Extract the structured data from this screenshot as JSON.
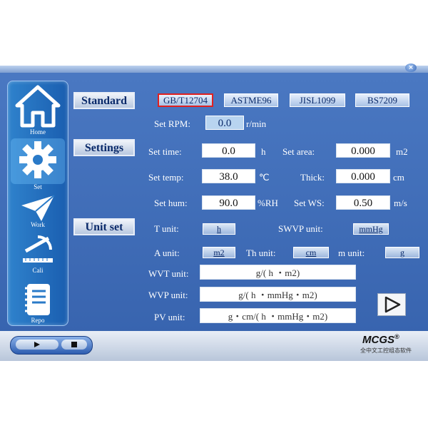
{
  "nav": [
    {
      "label": "Home",
      "icon": "home-icon"
    },
    {
      "label": "Set",
      "icon": "gear-icon"
    },
    {
      "label": "Work",
      "icon": "paper-plane-icon"
    },
    {
      "label": "Cali",
      "icon": "ruler-icon"
    },
    {
      "label": "Repo",
      "icon": "notebook-icon"
    }
  ],
  "sections": {
    "standard": "Standard",
    "settings": "Settings",
    "unit_set": "Unit set"
  },
  "standards": [
    "GB/T12704",
    "ASTME96",
    "JISL1099",
    "BS7209"
  ],
  "selected_standard": "GB/T12704",
  "rpm": {
    "label": "Set RPM:",
    "value": "0.0",
    "unit": "r/min"
  },
  "settings": {
    "time": {
      "label": "Set time:",
      "value": "0.0",
      "unit": "h"
    },
    "area": {
      "label": "Set area:",
      "value": "0.000",
      "unit": "m2"
    },
    "temp": {
      "label": "Set temp:",
      "value": "38.0",
      "unit": "℃"
    },
    "thick": {
      "label": "Thick:",
      "value": "0.000",
      "unit": "cm"
    },
    "hum": {
      "label": "Set hum:",
      "value": "90.0",
      "unit": "%RH"
    },
    "ws": {
      "label": "Set WS:",
      "value": "0.50",
      "unit": "m/s"
    }
  },
  "units": {
    "t": {
      "label": "T unit:",
      "value": "h"
    },
    "swvp": {
      "label": "SWVP unit:",
      "value": "mmHg"
    },
    "a": {
      "label": "A unit:",
      "value": "m2"
    },
    "th": {
      "label": "Th unit:",
      "value": "cm"
    },
    "m": {
      "label": "m unit:",
      "value": "g"
    },
    "wvt": {
      "label": "WVT unit:",
      "value": "g/( h ・m2)"
    },
    "wvp": {
      "label": "WVP unit:",
      "value": "g/( h ・mmHg・m2)"
    },
    "pv": {
      "label": "PV unit:",
      "value": "g・cm/( h ・mmHg・m2)"
    }
  },
  "brand": {
    "name": "MCGS",
    "reg": "®",
    "sub": "全中文工控组态软件"
  },
  "close_glyph": "×"
}
